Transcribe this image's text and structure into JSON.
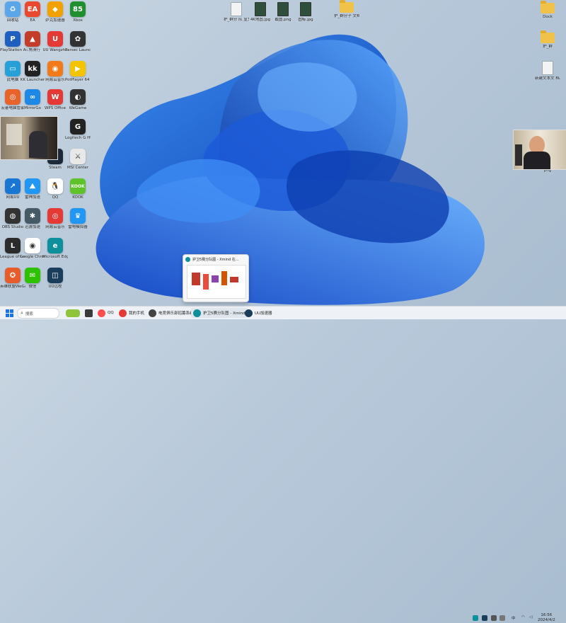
{
  "desktop": {
    "icons_left": [
      {
        "label": "回收站",
        "icon": "recycle-bin-icon",
        "color": "#5aa6e8",
        "glyph": "♻"
      },
      {
        "label": "EA",
        "icon": "ea-icon",
        "color": "#e8492f",
        "glyph": "EA"
      },
      {
        "label": "萨克加速器",
        "icon": "accelerator-icon",
        "color": "#f2a100",
        "glyph": "◆"
      },
      {
        "label": "Xbox",
        "icon": "game-icon",
        "color": "#1f8f2f",
        "glyph": "85"
      },
      {
        "label": "PlayStation Accessories",
        "icon": "playstation-icon",
        "color": "#1f5fbf",
        "glyph": "P"
      },
      {
        "label": "三角洲行",
        "icon": "game-delta-icon",
        "color": "#c43d2a",
        "glyph": "▲"
      },
      {
        "label": "UU Wangzhe",
        "icon": "uu-icon",
        "color": "#e53935",
        "glyph": "U"
      },
      {
        "label": "Parsec Launcher V",
        "icon": "parsec-icon",
        "color": "#333333",
        "glyph": "✿"
      },
      {
        "label": "此电脑",
        "icon": "computer-icon",
        "color": "#27a0d8",
        "glyph": "▭"
      },
      {
        "label": "KK Launcher",
        "icon": "kk-icon",
        "color": "#222222",
        "glyph": "kk"
      },
      {
        "label": "网易云音乐",
        "icon": "orange-app-icon",
        "color": "#f27a1a",
        "glyph": "◉"
      },
      {
        "label": "PotPlayer 64 bit",
        "icon": "potplayer-icon",
        "color": "#f5c400",
        "glyph": "▶"
      },
      {
        "label": "宏碁电脑管家",
        "icon": "manager-icon",
        "color": "#e8632a",
        "glyph": "◎"
      },
      {
        "label": "MirrorGo",
        "icon": "mirror-icon",
        "color": "#1e88e5",
        "glyph": "∞"
      },
      {
        "label": "WPS Office",
        "icon": "wps-icon",
        "color": "#e53935",
        "glyph": "W"
      },
      {
        "label": "WeGame",
        "icon": "wegame-icon",
        "color": "#333333",
        "glyph": "◐"
      },
      {
        "label": "Logitech G HUB",
        "icon": "logitech-icon",
        "color": "#222222",
        "glyph": "G"
      },
      {
        "label": "Steam",
        "icon": "steam-icon",
        "color": "#1b2838",
        "glyph": "⚙"
      },
      {
        "label": "MSI Center",
        "icon": "msi-icon",
        "color": "#e8e8e8",
        "glyph": "⚔"
      },
      {
        "label": "网易UU",
        "icon": "blue-app-icon",
        "color": "#1976d2",
        "glyph": "↗"
      },
      {
        "label": "雷神加速",
        "icon": "accel2-icon",
        "color": "#2196f3",
        "glyph": "⛰"
      },
      {
        "label": "QQ",
        "icon": "qq-icon",
        "color": "#ffffff",
        "glyph": "🐧"
      },
      {
        "label": "KOOK",
        "icon": "kook-icon",
        "color": "#5fc22b",
        "glyph": "KOOK"
      },
      {
        "label": "OBS Studio",
        "icon": "obs-icon",
        "color": "#333333",
        "glyph": "◍"
      },
      {
        "label": "迅游加速",
        "icon": "gear-app-icon",
        "color": "#455a64",
        "glyph": "✱"
      },
      {
        "label": "网易云音乐",
        "icon": "netease-icon",
        "color": "#e53935",
        "glyph": "◎"
      },
      {
        "label": "雷电模拟器",
        "icon": "emulator-icon",
        "color": "#2196f3",
        "glyph": "♛"
      },
      {
        "label": "League of Legends",
        "icon": "lol-icon",
        "color": "#2b2b2b",
        "glyph": "L"
      },
      {
        "label": "Google Chrome",
        "icon": "chrome-icon",
        "color": "#ffffff",
        "glyph": "◉"
      },
      {
        "label": "Microsoft Edge",
        "icon": "edge-icon",
        "color": "#0e8f9c",
        "glyph": "e"
      },
      {
        "label": "英雄联盟WeGame版",
        "icon": "hero-icon",
        "color": "#e65c2a",
        "glyph": "✪"
      },
      {
        "label": "微信",
        "icon": "wechat-icon",
        "color": "#2dc100",
        "glyph": "✉"
      },
      {
        "label": "UU远程",
        "icon": "uuremote-icon",
        "color": "#1a3d5c",
        "glyph": "◫"
      }
    ],
    "icons_top": [
      {
        "label": "护_群分 队 显文",
        "icon": "file-icon"
      },
      {
        "label": "4K地图.jpg",
        "icon": "image-icon"
      },
      {
        "label": "截图.png",
        "icon": "image-icon"
      },
      {
        "label": "图标.jpg",
        "icon": "image-icon"
      },
      {
        "label": "护_群分子 文档",
        "icon": "folder-icon"
      }
    ],
    "icons_right": [
      {
        "label": "Dock",
        "icon": "folder-icon"
      },
      {
        "label": "护_群",
        "icon": "folder-icon"
      },
      {
        "label": "新建文本文 档.txt",
        "icon": "file-icon"
      },
      {
        "label": "png",
        "icon": "image-icon"
      }
    ]
  },
  "taskbar": {
    "search_placeholder": "搜索",
    "items": [
      {
        "label": "QQ",
        "icon": "qq-icon",
        "color": "#ff4d4d"
      },
      {
        "label": "我的手机",
        "icon": "phone-icon",
        "color": "#e53935"
      },
      {
        "label": "电竞俱乐部招募系统",
        "icon": "app-icon",
        "color": "#444444"
      },
      {
        "label": "护卫5赛分队图 - Xmind",
        "icon": "edge-icon",
        "color": "#0e8f9c"
      },
      {
        "label": "UU加速器",
        "icon": "uu-icon",
        "color": "#1a3d5c"
      }
    ],
    "tray": {
      "lang": "中",
      "time": "16:56",
      "date": "2024/4/2"
    }
  },
  "thumbnail": {
    "title": "护卫5赛分队图 - Xmind 在..."
  }
}
